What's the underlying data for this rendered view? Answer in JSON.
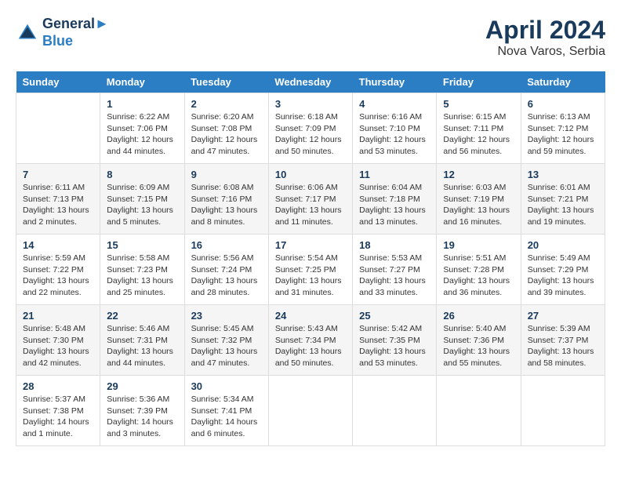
{
  "header": {
    "logo_line1": "General",
    "logo_line2": "Blue",
    "month_year": "April 2024",
    "location": "Nova Varos, Serbia"
  },
  "weekdays": [
    "Sunday",
    "Monday",
    "Tuesday",
    "Wednesday",
    "Thursday",
    "Friday",
    "Saturday"
  ],
  "weeks": [
    [
      {
        "day": "",
        "info": ""
      },
      {
        "day": "1",
        "info": "Sunrise: 6:22 AM\nSunset: 7:06 PM\nDaylight: 12 hours\nand 44 minutes."
      },
      {
        "day": "2",
        "info": "Sunrise: 6:20 AM\nSunset: 7:08 PM\nDaylight: 12 hours\nand 47 minutes."
      },
      {
        "day": "3",
        "info": "Sunrise: 6:18 AM\nSunset: 7:09 PM\nDaylight: 12 hours\nand 50 minutes."
      },
      {
        "day": "4",
        "info": "Sunrise: 6:16 AM\nSunset: 7:10 PM\nDaylight: 12 hours\nand 53 minutes."
      },
      {
        "day": "5",
        "info": "Sunrise: 6:15 AM\nSunset: 7:11 PM\nDaylight: 12 hours\nand 56 minutes."
      },
      {
        "day": "6",
        "info": "Sunrise: 6:13 AM\nSunset: 7:12 PM\nDaylight: 12 hours\nand 59 minutes."
      }
    ],
    [
      {
        "day": "7",
        "info": "Sunrise: 6:11 AM\nSunset: 7:13 PM\nDaylight: 13 hours\nand 2 minutes."
      },
      {
        "day": "8",
        "info": "Sunrise: 6:09 AM\nSunset: 7:15 PM\nDaylight: 13 hours\nand 5 minutes."
      },
      {
        "day": "9",
        "info": "Sunrise: 6:08 AM\nSunset: 7:16 PM\nDaylight: 13 hours\nand 8 minutes."
      },
      {
        "day": "10",
        "info": "Sunrise: 6:06 AM\nSunset: 7:17 PM\nDaylight: 13 hours\nand 11 minutes."
      },
      {
        "day": "11",
        "info": "Sunrise: 6:04 AM\nSunset: 7:18 PM\nDaylight: 13 hours\nand 13 minutes."
      },
      {
        "day": "12",
        "info": "Sunrise: 6:03 AM\nSunset: 7:19 PM\nDaylight: 13 hours\nand 16 minutes."
      },
      {
        "day": "13",
        "info": "Sunrise: 6:01 AM\nSunset: 7:21 PM\nDaylight: 13 hours\nand 19 minutes."
      }
    ],
    [
      {
        "day": "14",
        "info": "Sunrise: 5:59 AM\nSunset: 7:22 PM\nDaylight: 13 hours\nand 22 minutes."
      },
      {
        "day": "15",
        "info": "Sunrise: 5:58 AM\nSunset: 7:23 PM\nDaylight: 13 hours\nand 25 minutes."
      },
      {
        "day": "16",
        "info": "Sunrise: 5:56 AM\nSunset: 7:24 PM\nDaylight: 13 hours\nand 28 minutes."
      },
      {
        "day": "17",
        "info": "Sunrise: 5:54 AM\nSunset: 7:25 PM\nDaylight: 13 hours\nand 31 minutes."
      },
      {
        "day": "18",
        "info": "Sunrise: 5:53 AM\nSunset: 7:27 PM\nDaylight: 13 hours\nand 33 minutes."
      },
      {
        "day": "19",
        "info": "Sunrise: 5:51 AM\nSunset: 7:28 PM\nDaylight: 13 hours\nand 36 minutes."
      },
      {
        "day": "20",
        "info": "Sunrise: 5:49 AM\nSunset: 7:29 PM\nDaylight: 13 hours\nand 39 minutes."
      }
    ],
    [
      {
        "day": "21",
        "info": "Sunrise: 5:48 AM\nSunset: 7:30 PM\nDaylight: 13 hours\nand 42 minutes."
      },
      {
        "day": "22",
        "info": "Sunrise: 5:46 AM\nSunset: 7:31 PM\nDaylight: 13 hours\nand 44 minutes."
      },
      {
        "day": "23",
        "info": "Sunrise: 5:45 AM\nSunset: 7:32 PM\nDaylight: 13 hours\nand 47 minutes."
      },
      {
        "day": "24",
        "info": "Sunrise: 5:43 AM\nSunset: 7:34 PM\nDaylight: 13 hours\nand 50 minutes."
      },
      {
        "day": "25",
        "info": "Sunrise: 5:42 AM\nSunset: 7:35 PM\nDaylight: 13 hours\nand 53 minutes."
      },
      {
        "day": "26",
        "info": "Sunrise: 5:40 AM\nSunset: 7:36 PM\nDaylight: 13 hours\nand 55 minutes."
      },
      {
        "day": "27",
        "info": "Sunrise: 5:39 AM\nSunset: 7:37 PM\nDaylight: 13 hours\nand 58 minutes."
      }
    ],
    [
      {
        "day": "28",
        "info": "Sunrise: 5:37 AM\nSunset: 7:38 PM\nDaylight: 14 hours\nand 1 minute."
      },
      {
        "day": "29",
        "info": "Sunrise: 5:36 AM\nSunset: 7:39 PM\nDaylight: 14 hours\nand 3 minutes."
      },
      {
        "day": "30",
        "info": "Sunrise: 5:34 AM\nSunset: 7:41 PM\nDaylight: 14 hours\nand 6 minutes."
      },
      {
        "day": "",
        "info": ""
      },
      {
        "day": "",
        "info": ""
      },
      {
        "day": "",
        "info": ""
      },
      {
        "day": "",
        "info": ""
      }
    ]
  ]
}
